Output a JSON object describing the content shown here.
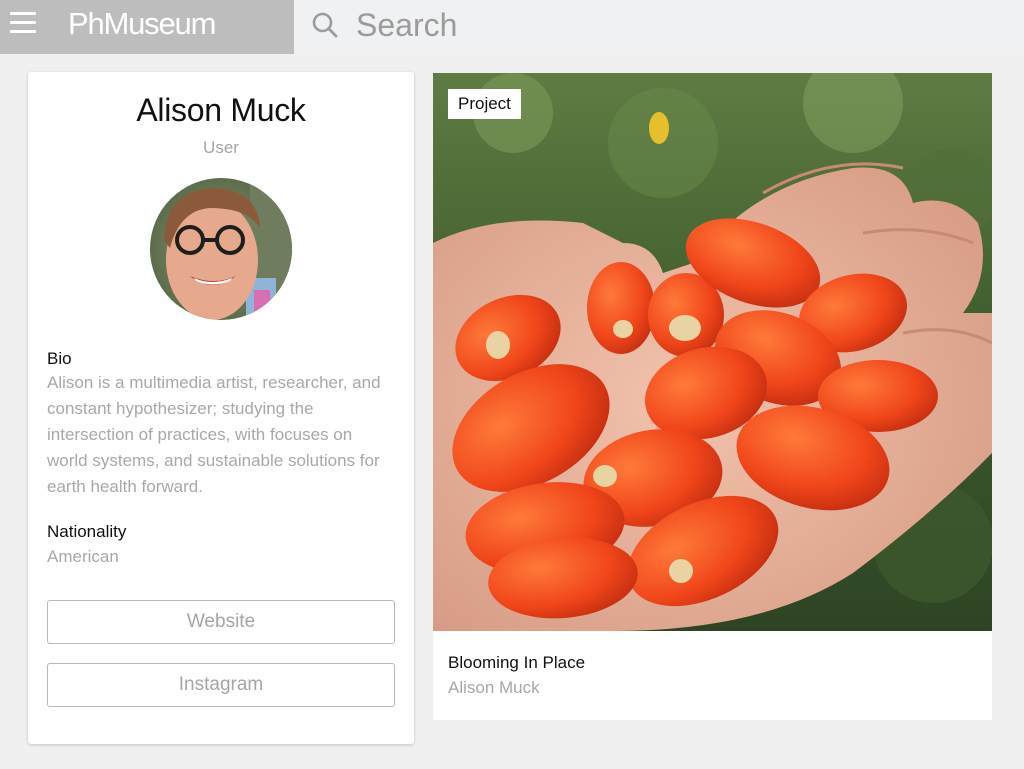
{
  "header": {
    "logo": "PhMuseum",
    "search_placeholder": "Search"
  },
  "profile": {
    "name": "Alison Muck",
    "role": "User",
    "bio_label": "Bio",
    "bio_text": "Alison is a multimedia artist, researcher, and constant hypothesizer; studying the intersection of practices, with focuses on world systems, and sustainable solutions for earth health forward.",
    "nationality_label": "Nationality",
    "nationality_value": "American",
    "website_label": "Website",
    "instagram_label": "Instagram"
  },
  "project": {
    "tag": "Project",
    "title": "Blooming In Place",
    "author": "Alison Muck"
  },
  "colors": {
    "brand_bar": "#bdbdbd",
    "page_background": "#f0f0f0",
    "muted_text": "#a8a8a8"
  }
}
